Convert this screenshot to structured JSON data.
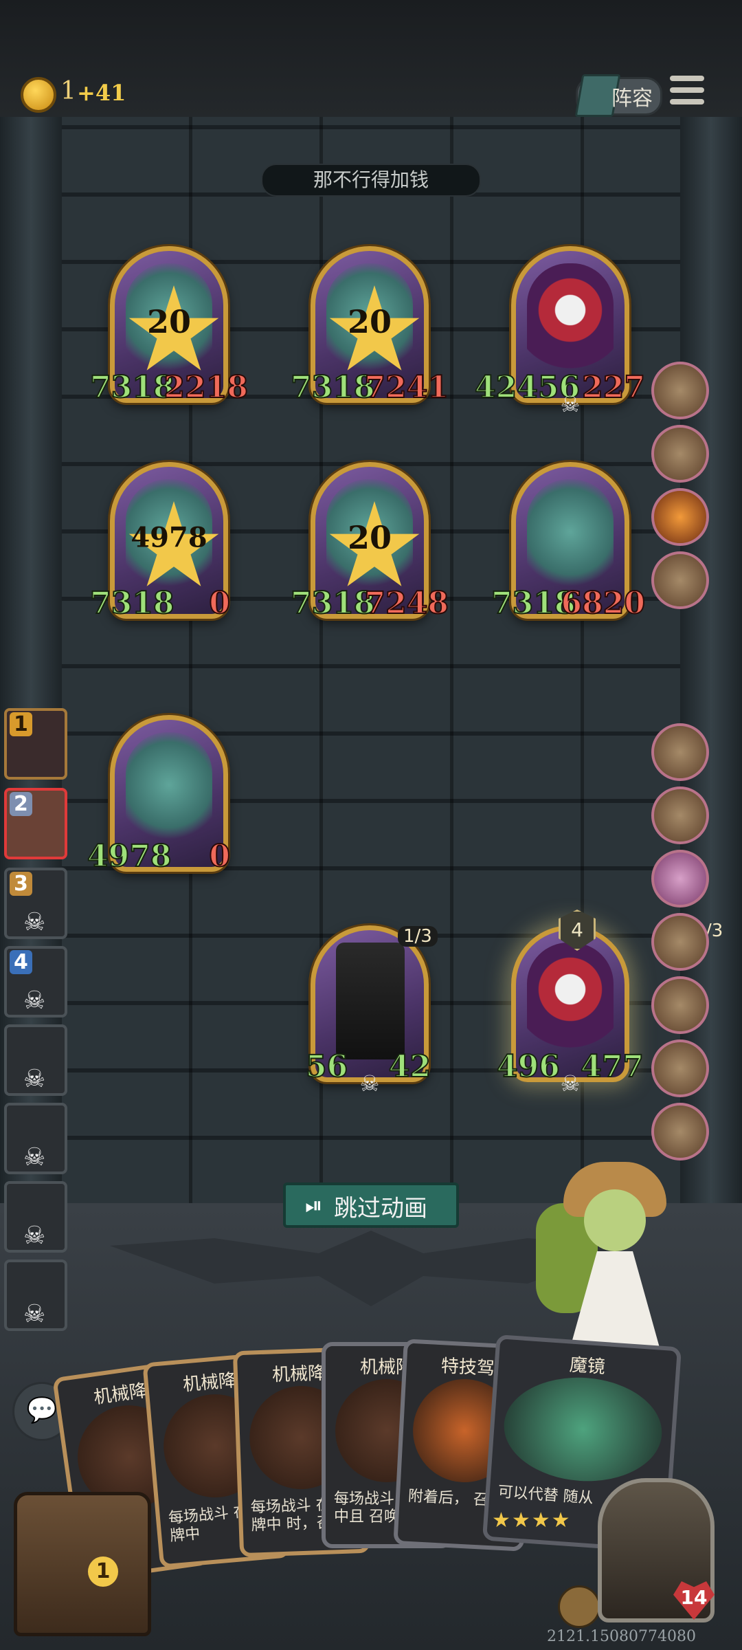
{
  "top_bar": {
    "coin_value": "1",
    "coin_delta": "+41",
    "lineup_label": "阵容"
  },
  "opponent_name": "那不行得加钱",
  "enemy_board": [
    {
      "attack": "7318",
      "health": "2218",
      "badge": "20",
      "art": "ghost"
    },
    {
      "attack": "7318",
      "health": "7241",
      "badge": "20",
      "art": "ghost"
    },
    {
      "attack": "42456",
      "health": "227",
      "badge": "",
      "art": "clown"
    },
    {
      "attack": "7318",
      "health": "0",
      "badge": "4978",
      "art": "ghost"
    },
    {
      "attack": "7318",
      "health": "7248",
      "badge": "20",
      "art": "ghost"
    },
    {
      "attack": "7318",
      "health": "6820",
      "badge": "",
      "art": "ghost"
    }
  ],
  "player_board": [
    {
      "attack": "4978",
      "health": "0",
      "art": "ghost"
    },
    {
      "attack": "56",
      "health": "42",
      "counter": "1/3",
      "art": "robot"
    },
    {
      "attack": "496",
      "health": "477",
      "tier": "4",
      "counter": "/3",
      "art": "clown"
    }
  ],
  "turn_order": [
    "1",
    "2",
    "3",
    "4",
    "",
    "",
    "",
    ""
  ],
  "skip_button": "跳过动画",
  "hand": [
    {
      "title": "机械降",
      "desc": ""
    },
    {
      "title": "机械降",
      "desc": "每场战斗 在手牌中"
    },
    {
      "title": "机械降",
      "desc": "每场战斗 在手牌中 时，召唤"
    },
    {
      "title": "机械降",
      "desc": "每场战斗 手牌中且 召唤1个"
    },
    {
      "title": "特技驾",
      "desc": "附着后， 召唤1"
    },
    {
      "title": "魔镜",
      "desc": "可以代替 随从"
    }
  ],
  "chest_count": "1",
  "player_health": "14",
  "seed": "2121.15080774080",
  "colors": {
    "attack": "#9fe07a",
    "health": "#f06a5a",
    "frame_gold": "#c99a3a",
    "skip_button_bg": "#2a6a5e"
  },
  "icons": [
    "coin-icon",
    "book-icon",
    "menu-icon",
    "skull-icon",
    "chat-icon",
    "chest-icon",
    "heart-icon",
    "play-skip-icon"
  ]
}
